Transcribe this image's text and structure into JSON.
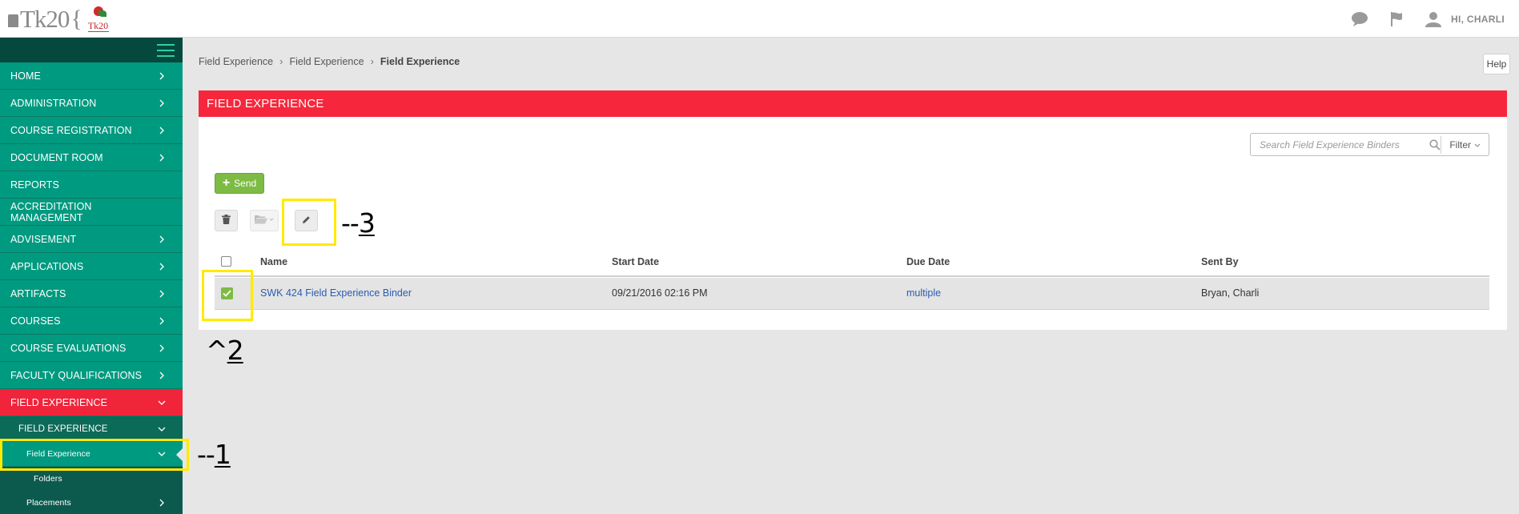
{
  "app": {
    "logo_text": "Tk20",
    "logo_brace": "{",
    "logo_badge_text": "Tk20"
  },
  "topbar": {
    "user_label": "HI, CHARLI",
    "icons": [
      "chat-icon",
      "flag-icon",
      "user-icon"
    ]
  },
  "sidebar": {
    "items": [
      {
        "label": "HOME",
        "chevron": "right"
      },
      {
        "label": "ADMINISTRATION",
        "chevron": "right"
      },
      {
        "label": "COURSE REGISTRATION",
        "chevron": "right"
      },
      {
        "label": "DOCUMENT ROOM",
        "chevron": "right"
      },
      {
        "label": "REPORTS",
        "chevron": ""
      },
      {
        "label": "ACCREDITATION MANAGEMENT",
        "chevron": ""
      },
      {
        "label": "ADVISEMENT",
        "chevron": "right"
      },
      {
        "label": "APPLICATIONS",
        "chevron": "right"
      },
      {
        "label": "ARTIFACTS",
        "chevron": "right"
      },
      {
        "label": "COURSES",
        "chevron": "right"
      },
      {
        "label": "COURSE EVALUATIONS",
        "chevron": "right"
      },
      {
        "label": "FACULTY QUALIFICATIONS",
        "chevron": "right"
      },
      {
        "label": "FIELD EXPERIENCE",
        "chevron": "down"
      }
    ],
    "sub1": {
      "label": "FIELD EXPERIENCE"
    },
    "sub2": {
      "label": "Field Experience"
    },
    "sub3": {
      "label": "Folders"
    },
    "sub4": {
      "label": "Placements"
    }
  },
  "breadcrumb": {
    "items": [
      "Field Experience",
      "Field Experience",
      "Field Experience"
    ],
    "separator": "›"
  },
  "help_label": "Help",
  "panel": {
    "title": "FIELD EXPERIENCE"
  },
  "search": {
    "placeholder": "Search Field Experience Binders",
    "filter_label": "Filter"
  },
  "toolbar": {
    "send_label": "Send",
    "send_icon": "+"
  },
  "table": {
    "headers": [
      "Name",
      "Start Date",
      "Due Date",
      "Sent By"
    ],
    "rows": [
      {
        "checked": true,
        "name": "SWK 424 Field Experience Binder",
        "start_date": "09/21/2016 02:16 PM",
        "due_date": "multiple",
        "sent_by": "Bryan, Charli"
      }
    ]
  },
  "annotations": {
    "a1": {
      "prefix": "--",
      "num": "1"
    },
    "a2": {
      "prefix": "^",
      "num": "2"
    },
    "a3": {
      "prefix": "--",
      "num": "3"
    }
  },
  "colors": {
    "accent_red": "#f6273c",
    "sidebar_teal": "#009a80",
    "sidebar_dark": "#0c5a4d",
    "send_green": "#7dbb45",
    "highlight_yellow": "#ffea00",
    "link_blue": "#2a5db0"
  }
}
